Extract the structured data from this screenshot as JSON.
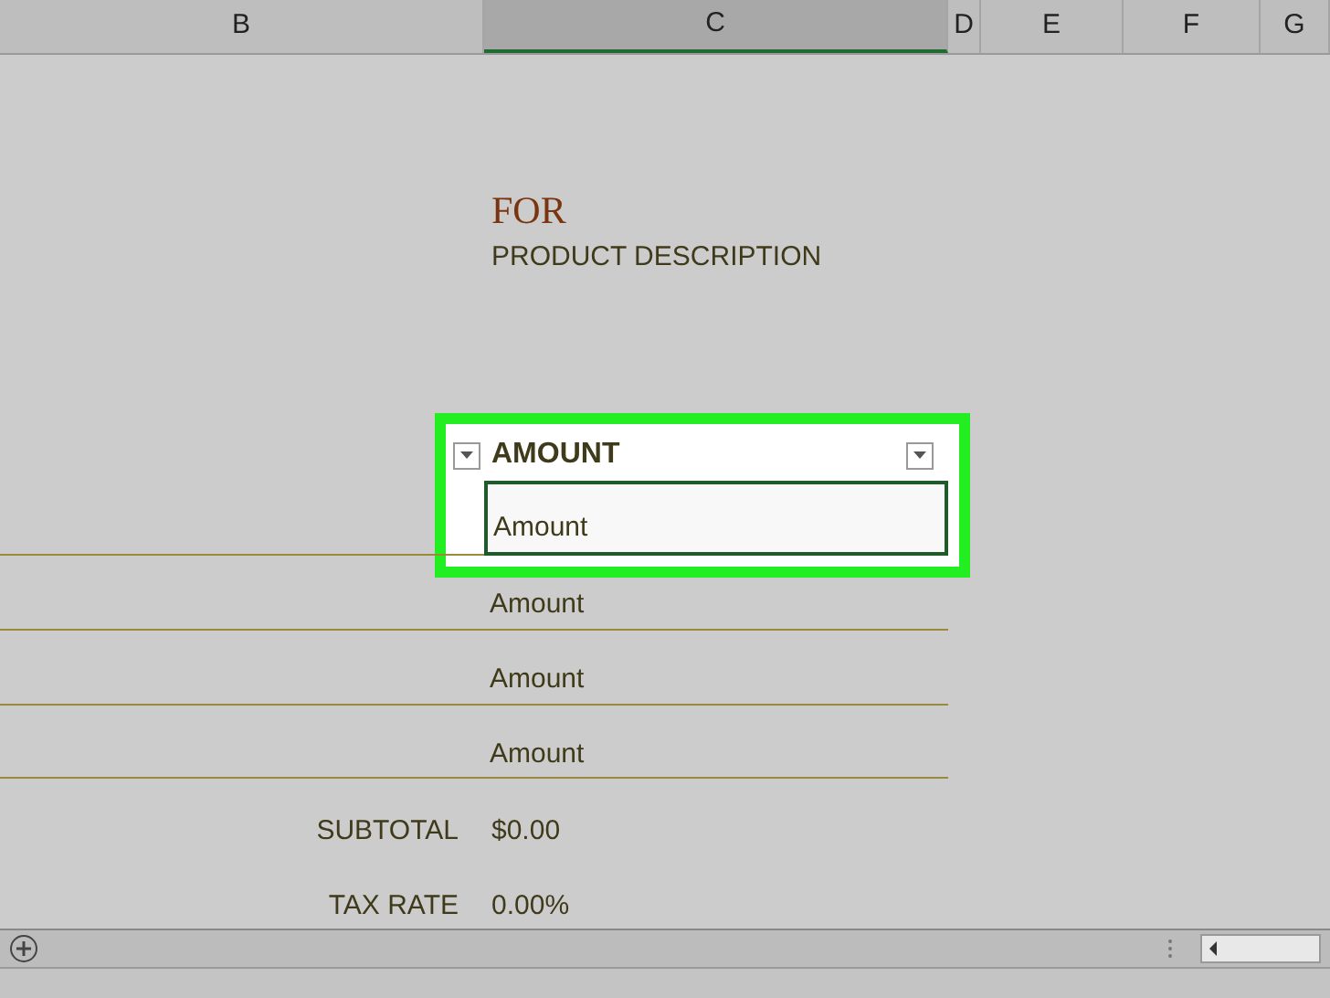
{
  "columns": [
    {
      "label": "B",
      "selected": false
    },
    {
      "label": "C",
      "selected": true
    },
    {
      "label": "D",
      "selected": false
    },
    {
      "label": "E",
      "selected": false
    },
    {
      "label": "F",
      "selected": false
    },
    {
      "label": "G",
      "selected": false
    }
  ],
  "title": "FOR",
  "subtitle": "PRODUCT DESCRIPTION",
  "table": {
    "header": "AMOUNT",
    "highlighted": true,
    "rows": [
      {
        "value": "Amount",
        "selected": true
      },
      {
        "value": "Amount",
        "selected": false
      },
      {
        "value": "Amount",
        "selected": false
      },
      {
        "value": "Amount",
        "selected": false
      }
    ]
  },
  "summary": [
    {
      "label": "SUBTOTAL",
      "value": "$0.00"
    },
    {
      "label": "TAX RATE",
      "value": "0.00%"
    }
  ]
}
